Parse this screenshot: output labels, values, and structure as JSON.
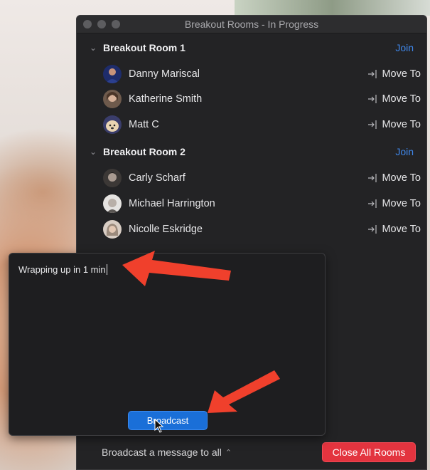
{
  "window": {
    "title": "Breakout Rooms - In Progress"
  },
  "rooms": [
    {
      "name": "Breakout Room 1",
      "join_label": "Join",
      "participants": [
        {
          "name": "Danny Mariscal",
          "action": "Move To",
          "avatar_color": "#2b3f8f"
        },
        {
          "name": "Katherine Smith",
          "action": "Move To",
          "avatar_color": "#8d7663"
        },
        {
          "name": "Matt C",
          "action": "Move To",
          "avatar_color": "#c9a27a"
        }
      ]
    },
    {
      "name": "Breakout Room 2",
      "join_label": "Join",
      "participants": [
        {
          "name": "Carly Scharf",
          "action": "Move To",
          "avatar_color": "#5a5450"
        },
        {
          "name": "Michael Harrington",
          "action": "Move To",
          "avatar_color": "#d9d6d3"
        },
        {
          "name": "Nicolle Eskridge",
          "action": "Move To",
          "avatar_color": "#cdbfb3"
        }
      ]
    }
  ],
  "broadcast": {
    "message": "Wrapping up in 1 min",
    "button_label": "Broadcast"
  },
  "footer": {
    "broadcast_link": "Broadcast a message to all",
    "close_all_label": "Close All Rooms"
  },
  "colors": {
    "accent_blue": "#1a6fd8",
    "join_blue": "#3f86e8",
    "danger_red": "#e3343f",
    "annotation_arrow": "#f0402c"
  }
}
